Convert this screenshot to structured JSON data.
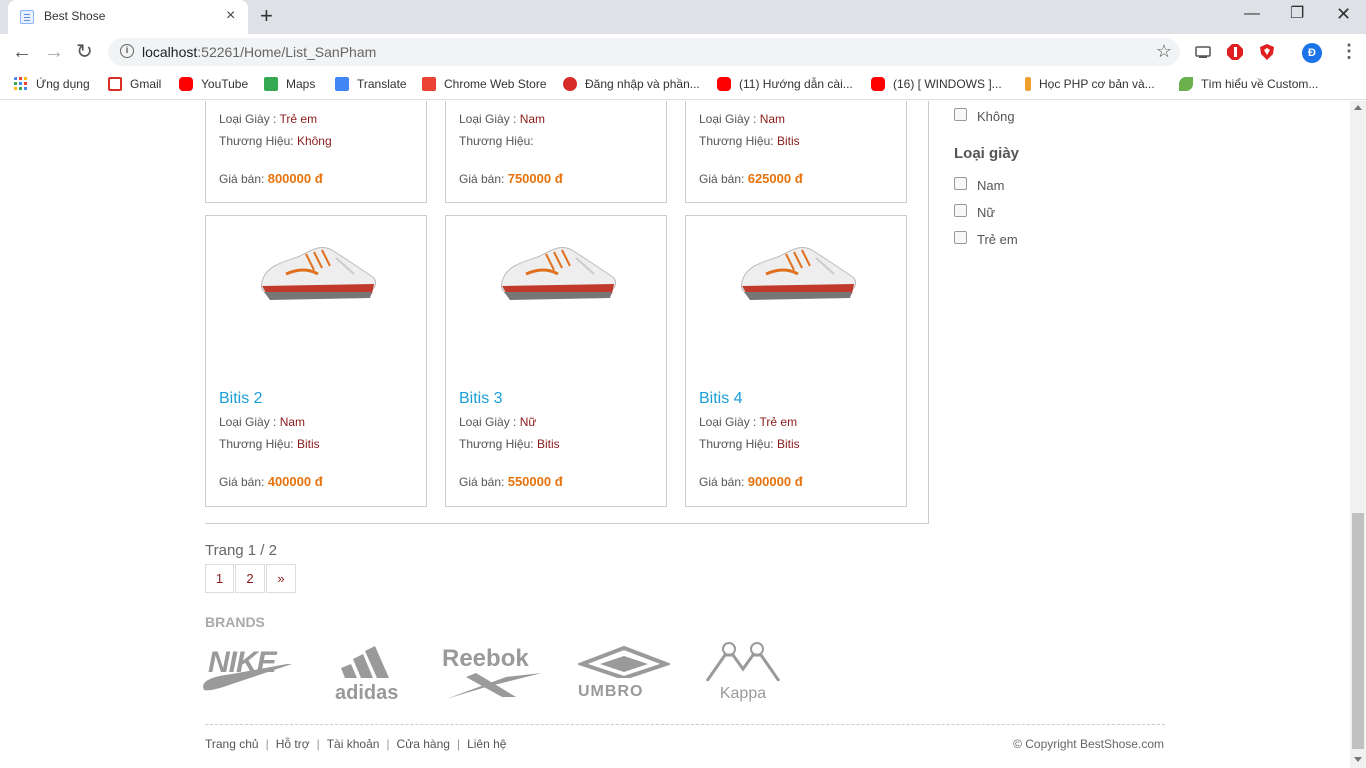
{
  "browser": {
    "tab_title": "Best Shose",
    "tab_close": "×",
    "new_tab": "+",
    "url_host": "localhost",
    "url_rest": ":52261/Home/List_SanPham",
    "profile_initial": "Đ",
    "bookmarks": [
      {
        "label": "Ứng dụng",
        "icon": "apps-grid-icon",
        "color": "#4285f4"
      },
      {
        "label": "Gmail",
        "icon": "gmail-icon",
        "color": "#d93025"
      },
      {
        "label": "YouTube",
        "icon": "youtube-icon",
        "color": "#ff0000"
      },
      {
        "label": "Maps",
        "icon": "maps-icon",
        "color": "#34a853"
      },
      {
        "label": "Translate",
        "icon": "translate-icon",
        "color": "#4285f4"
      },
      {
        "label": "Chrome Web Store",
        "icon": "webstore-icon",
        "color": "#ea4335"
      },
      {
        "label": "Đăng nhập và phần...",
        "icon": "globe-icon",
        "color": "#d62b2b"
      },
      {
        "label": "(11) Hướng dẫn cài...",
        "icon": "youtube-icon",
        "color": "#ff0000"
      },
      {
        "label": "(16) [ WINDOWS ]...",
        "icon": "youtube-icon",
        "color": "#ff0000"
      },
      {
        "label": "Học PHP cơ bản và...",
        "icon": "j-icon",
        "color": "#f0a030"
      },
      {
        "label": "Tìm hiểu về Custom...",
        "icon": "leaf-icon",
        "color": "#6ab04c"
      }
    ]
  },
  "products_top": [
    {
      "type_label": "Loại Giày :",
      "type": "Trẻ em",
      "brand_label": "Thương Hiệu:",
      "brand": "Không",
      "price_label": "Giá bán:",
      "price": "800000 đ"
    },
    {
      "type_label": "Loại Giày :",
      "type": "Nam",
      "brand_label": "Thương Hiệu:",
      "brand": "",
      "price_label": "Giá bán:",
      "price": "750000 đ"
    },
    {
      "type_label": "Loại Giày :",
      "type": "Nam",
      "brand_label": "Thương Hiệu:",
      "brand": "Bitis",
      "price_label": "Giá bán:",
      "price": "625000 đ"
    }
  ],
  "products": [
    {
      "name": "Bitis 2",
      "type_label": "Loại Giày :",
      "type": "Nam",
      "brand_label": "Thương Hiệu:",
      "brand": "Bitis",
      "price_label": "Giá bán:",
      "price": "400000 đ"
    },
    {
      "name": "Bitis 3",
      "type_label": "Loại Giày :",
      "type": "Nữ",
      "brand_label": "Thương Hiệu:",
      "brand": "Bitis",
      "price_label": "Giá bán:",
      "price": "550000 đ"
    },
    {
      "name": "Bitis 4",
      "type_label": "Loại Giày :",
      "type": "Trẻ em",
      "brand_label": "Thương Hiệu:",
      "brand": "Bitis",
      "price_label": "Giá bán:",
      "price": "900000 đ"
    }
  ],
  "filters": {
    "brand_last_option": "Không",
    "type_title": "Loại giày",
    "type_options": [
      "Nam",
      "Nữ",
      "Trẻ em"
    ]
  },
  "pager": {
    "text": "Trang 1 / 2",
    "pages": [
      "1",
      "2",
      "»"
    ]
  },
  "brands": {
    "title": "BRANDS",
    "logos": [
      "NIKE",
      "adidas",
      "Reebok",
      "UMBRO",
      "Kappa"
    ]
  },
  "footer": {
    "links": [
      "Trang chủ",
      "Hỗ trợ",
      "Tài khoản",
      "Cửa hàng",
      "Liên hệ"
    ],
    "copyright": "© Copyright BestShose.com"
  }
}
